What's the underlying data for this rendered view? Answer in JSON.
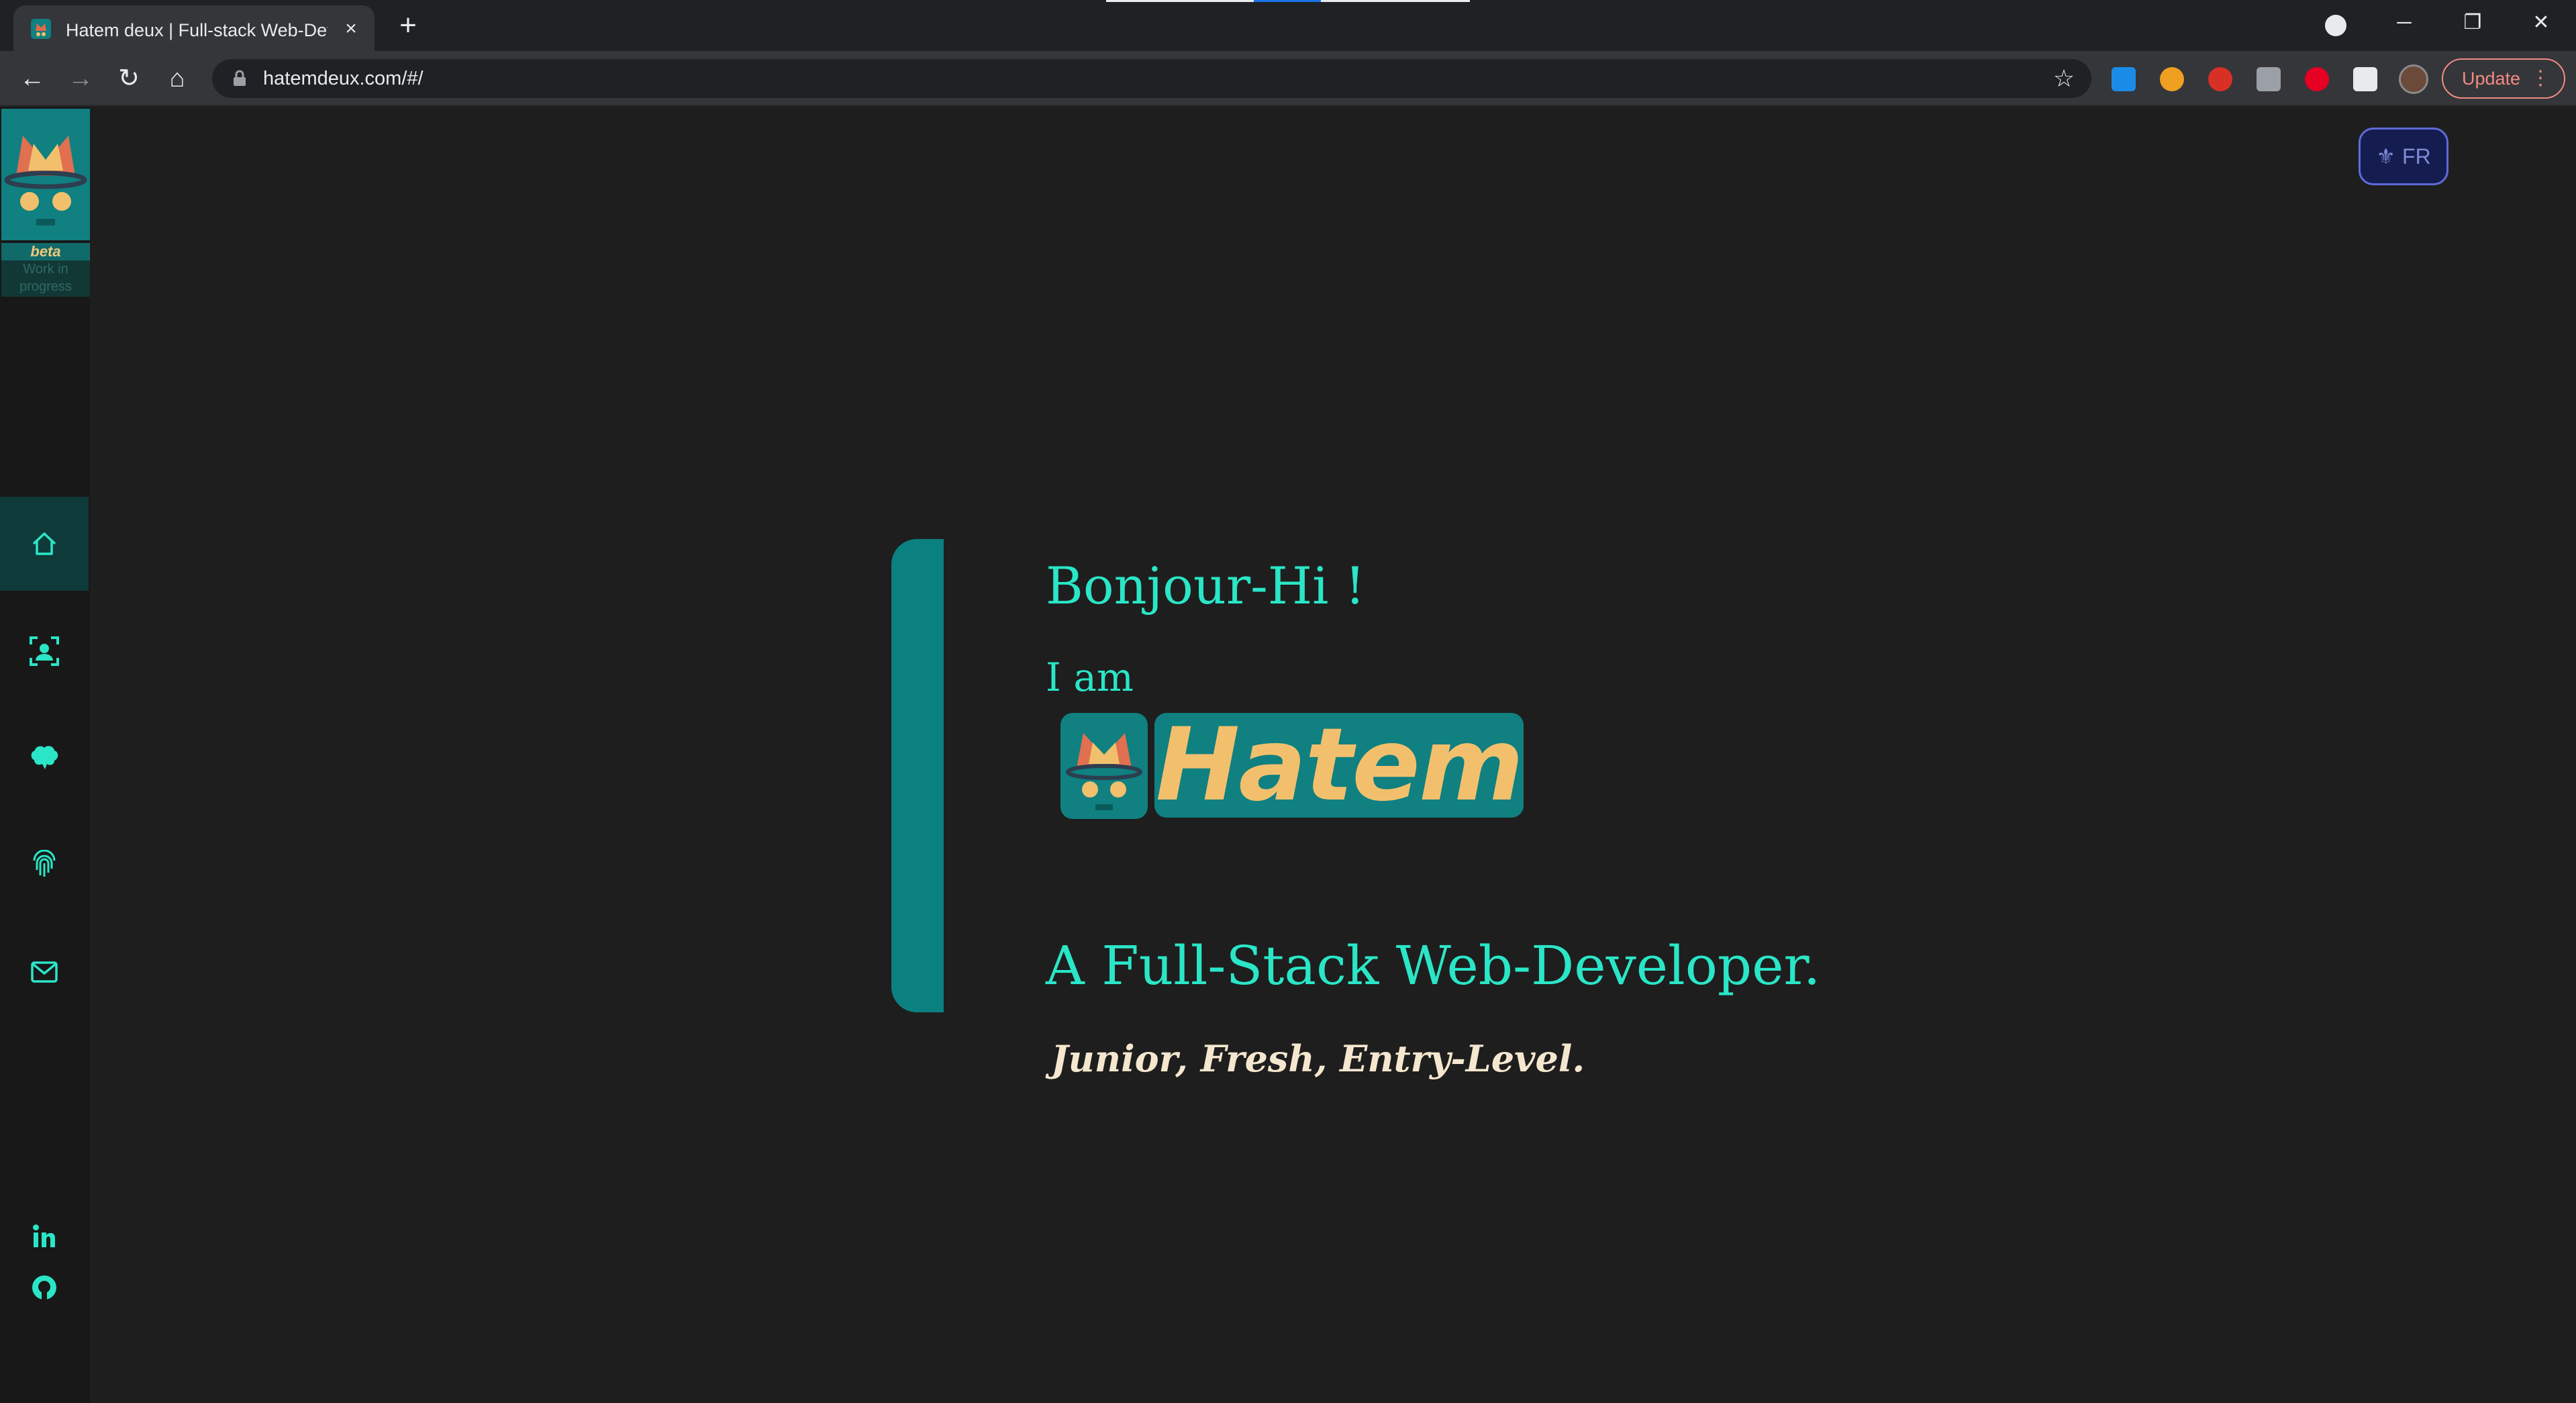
{
  "browser": {
    "tab_title": "Hatem deux | Full-stack Web-Developer",
    "tab_close": "×",
    "new_tab": "+",
    "url": "hatemdeux.com/#/",
    "update_label": "Update"
  },
  "window_controls": {
    "minimize": "─",
    "restore": "❐",
    "close": "✕"
  },
  "nav": {
    "back": "←",
    "forward": "→",
    "reload": "↻",
    "home": "⌂",
    "bookmark": "☆"
  },
  "sidebar": {
    "beta_label": "beta",
    "wip_label": "Work in progress",
    "items": [
      {
        "icon": "home-icon",
        "active": true
      },
      {
        "icon": "about-icon",
        "active": false
      },
      {
        "icon": "skills-brain-icon",
        "active": false
      },
      {
        "icon": "fingerprint-icon",
        "active": false
      },
      {
        "icon": "mail-icon",
        "active": false
      }
    ],
    "social": [
      "linkedin-icon",
      "github-icon"
    ]
  },
  "lang_toggle": {
    "label": "FR",
    "icon": "fleur-de-lis-icon"
  },
  "hero": {
    "greeting": "Bonjour-Hi !",
    "intro": "I am",
    "name": "Hatem",
    "role": "A Full-Stack Web-Developer.",
    "tagline": "Junior, Fresh, Entry-Level."
  },
  "colors": {
    "accent": "#2ae6c7",
    "teal": "#108080",
    "name_gold": "#f2c06d",
    "background": "#1e1e1e"
  }
}
